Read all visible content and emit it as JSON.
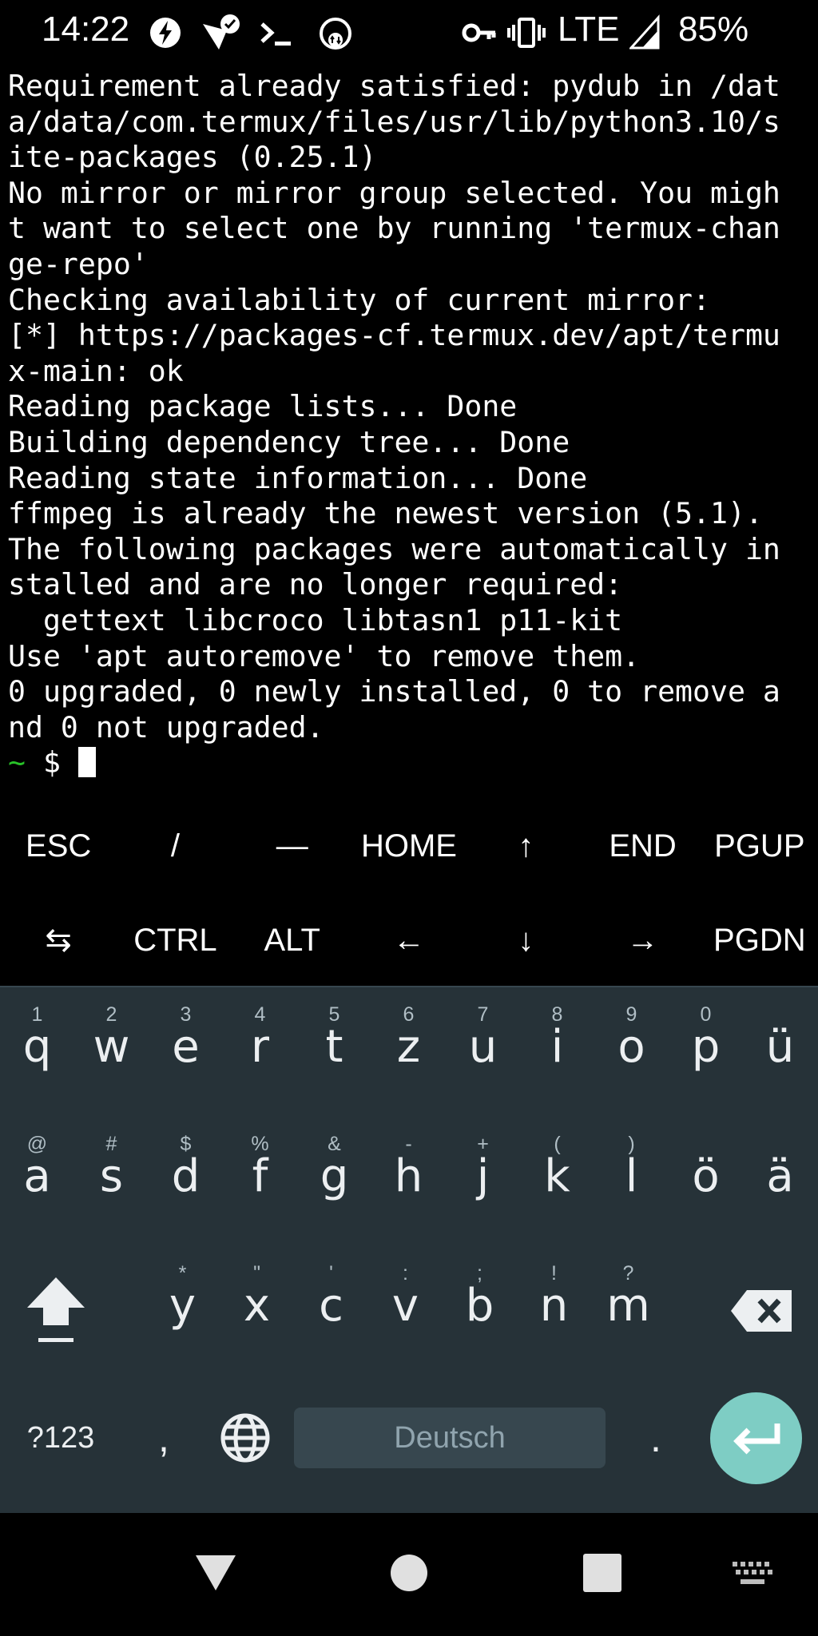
{
  "status_bar": {
    "time": "14:22",
    "network": "LTE",
    "battery": "85%",
    "icons": [
      "flash-icon",
      "vpn-check-icon",
      "terminal-icon",
      "sync-icon",
      "key-icon",
      "vibrate-icon",
      "signal-icon"
    ]
  },
  "terminal": {
    "lines": [
      "Requirement already satisfied: pydub in /dat",
      "a/data/com.termux/files/usr/lib/python3.10/s",
      "ite-packages (0.25.1)",
      "No mirror or mirror group selected. You migh",
      "t want to select one by running 'termux-chan",
      "ge-repo'",
      "Checking availability of current mirror:",
      "[*] https://packages-cf.termux.dev/apt/termu",
      "x-main: ok",
      "Reading package lists... Done",
      "Building dependency tree... Done",
      "Reading state information... Done",
      "ffmpeg is already the newest version (5.1).",
      "The following packages were automatically in",
      "stalled and are no longer required:",
      "  gettext libcroco libtasn1 p11-kit",
      "Use 'apt autoremove' to remove them.",
      "0 upgraded, 0 newly installed, 0 to remove a",
      "nd 0 not upgraded."
    ],
    "prompt_tilde": "~",
    "prompt_symbol": "$",
    "prompt_color": "#28c228"
  },
  "extra_keys": {
    "row1": [
      "ESC",
      "/",
      "—",
      "HOME",
      "↑",
      "END",
      "PGUP"
    ],
    "row2": [
      "⇆",
      "CTRL",
      "ALT",
      "←",
      "↓",
      "→",
      "PGDN"
    ]
  },
  "keyboard": {
    "row1": {
      "keys": [
        "q",
        "w",
        "e",
        "r",
        "t",
        "z",
        "u",
        "i",
        "o",
        "p",
        "ü"
      ],
      "hints": [
        "1",
        "2",
        "3",
        "4",
        "5",
        "6",
        "7",
        "8",
        "9",
        "0",
        ""
      ]
    },
    "row2": {
      "keys": [
        "a",
        "s",
        "d",
        "f",
        "g",
        "h",
        "j",
        "k",
        "l",
        "ö",
        "ä"
      ],
      "hints": [
        "@",
        "#",
        "$",
        "%",
        "&",
        "-",
        "+",
        "(",
        ")",
        "",
        ""
      ]
    },
    "row3": {
      "keys": [
        "y",
        "x",
        "c",
        "v",
        "b",
        "n",
        "m"
      ],
      "hints": [
        "*",
        "\"",
        "'",
        ":",
        ";",
        "!",
        "?"
      ]
    },
    "symbols_label": "?123",
    "comma": ",",
    "period": ".",
    "space_label": "Deutsch",
    "background": "#263238",
    "enter_color": "#7ecdc4"
  }
}
